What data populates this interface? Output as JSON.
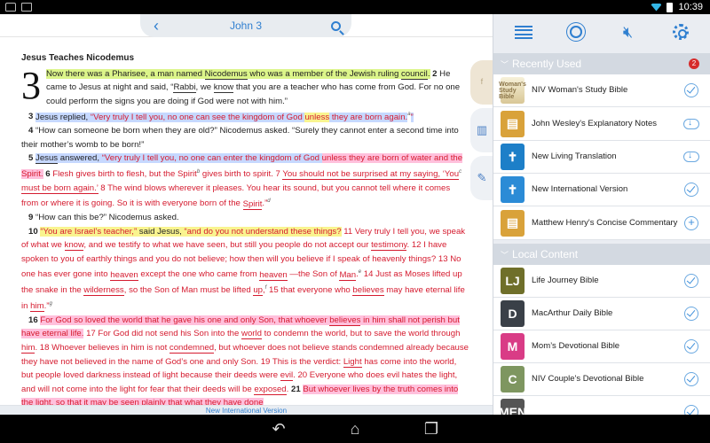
{
  "status_bar": {
    "time": "10:39"
  },
  "reader": {
    "title": "John 3",
    "heading": "Jesus Teaches Nicodemus",
    "chapter_number": "3",
    "version_label": "New International Version",
    "verses": [
      {
        "parts": [
          {
            "t": "Now there was a Pharisee, a man named ",
            "c": "hl-g"
          },
          {
            "t": "Nicodemus",
            "c": "hl-g ulb"
          },
          {
            "t": " who was a member of the Jewish ruling ",
            "c": "hl-g"
          },
          {
            "t": "council",
            "c": "hl-g ulb"
          },
          {
            "t": ".",
            "c": "hl-g"
          },
          {
            "t": " 2 ",
            "c": "vn"
          },
          {
            "t": "He came to Jesus at night and said, “",
            "c": ""
          },
          {
            "t": "Rabbi",
            "c": "ulb"
          },
          {
            "t": ", we ",
            "c": ""
          },
          {
            "t": "know",
            "c": "ulb"
          },
          {
            "t": " that you are a teacher who has come from God. For no one could perform the signs you are doing if God were not with him.”",
            "c": ""
          }
        ],
        "noindent": true
      },
      {
        "parts": [
          {
            "t": "3 ",
            "c": "vn"
          },
          {
            "t": "Jesus replied, ",
            "c": "hl-b"
          },
          {
            "t": "“Very truly I tell you, no one can see the kingdom of God ",
            "c": "hl-b red"
          },
          {
            "t": "unless",
            "c": "hl-y red"
          },
          {
            "t": " they are born again.",
            "c": "hl-b red"
          },
          {
            "t": "a",
            "c": "sup"
          },
          {
            "t": "”",
            "c": "hl-b red"
          }
        ]
      },
      {
        "parts": [
          {
            "t": "4 ",
            "c": "vn"
          },
          {
            "t": "“How can someone be born when they are old?” Nicodemus asked. “Surely they cannot enter a second time into their mother’s womb to be born!”",
            "c": ""
          }
        ]
      },
      {
        "parts": [
          {
            "t": "5 ",
            "c": "vn"
          },
          {
            "t": "Jesus",
            "c": "hl-b ulb"
          },
          {
            "t": " answered, ",
            "c": "hl-b"
          },
          {
            "t": "“Very truly I tell you, no one can enter the kingdom of God ",
            "c": "hl-b red"
          },
          {
            "t": "unless they are born of water and the Spirit.",
            "c": "hl-p red"
          },
          {
            "t": " 6 ",
            "c": "vn"
          },
          {
            "t": "Flesh gives birth to flesh, but the Spirit",
            "c": "red"
          },
          {
            "t": "b",
            "c": "sup"
          },
          {
            "t": " gives birth to spirit. 7 ",
            "c": "red"
          },
          {
            "t": "You should not be surprised at my saying, ‘You",
            "c": "red ul"
          },
          {
            "t": "c",
            "c": "sup"
          },
          {
            "t": " must be born again.’",
            "c": "red ul"
          },
          {
            "t": " 8 The wind blows wherever it pleases. You hear its sound, but you cannot tell where it comes from or where it is going. So it is with everyone born of the ",
            "c": "red"
          },
          {
            "t": "Spirit",
            "c": "red ul"
          },
          {
            "t": ".”",
            "c": "red"
          },
          {
            "t": "d",
            "c": "sup"
          }
        ]
      },
      {
        "parts": [
          {
            "t": "9 ",
            "c": "vn"
          },
          {
            "t": "“How can this be?” Nicodemus asked.",
            "c": ""
          }
        ]
      },
      {
        "parts": [
          {
            "t": "10 ",
            "c": "vn"
          },
          {
            "t": "“You are Israel’s teacher,”",
            "c": "hl-y red"
          },
          {
            "t": " said Jesus, ",
            "c": "hl-y"
          },
          {
            "t": "“and do you not understand these things?",
            "c": "hl-y red"
          },
          {
            "t": " 11 Very truly I tell you, we speak of what we ",
            "c": "red"
          },
          {
            "t": "know",
            "c": "red ul"
          },
          {
            "t": ", and we testify to what we have seen, but still you people do not accept our ",
            "c": "red"
          },
          {
            "t": "testimony",
            "c": "red ul"
          },
          {
            "t": ". 12 I have spoken to you of earthly things and you do not believe; how then will you believe if I speak of heavenly things? 13 No one has ever gone into ",
            "c": "red"
          },
          {
            "t": "heaven",
            "c": "red ul"
          },
          {
            "t": " except the one who came from ",
            "c": "red"
          },
          {
            "t": "heaven",
            "c": "red ul"
          },
          {
            "t": " —the Son of ",
            "c": "red"
          },
          {
            "t": "Man",
            "c": "red ul"
          },
          {
            "t": ".",
            "c": "red"
          },
          {
            "t": "e",
            "c": "sup"
          },
          {
            "t": " 14 Just as Moses lifted up the snake in the ",
            "c": "red"
          },
          {
            "t": "wilderness",
            "c": "red ul"
          },
          {
            "t": ", so the Son of Man must be lifted ",
            "c": "red"
          },
          {
            "t": "up",
            "c": "red ul"
          },
          {
            "t": ",",
            "c": "red"
          },
          {
            "t": "f",
            "c": "sup"
          },
          {
            "t": " 15 that everyone who ",
            "c": "red"
          },
          {
            "t": "believes",
            "c": "red ul"
          },
          {
            "t": " may have eternal life in ",
            "c": "red"
          },
          {
            "t": "him",
            "c": "red ul"
          },
          {
            "t": ".”",
            "c": "red"
          },
          {
            "t": "g",
            "c": "sup"
          }
        ]
      },
      {
        "parts": [
          {
            "t": "16 ",
            "c": "vn"
          },
          {
            "t": "For God so loved the world that he gave his one and only Son, that whoever ",
            "c": "hl-p red"
          },
          {
            "t": "believes",
            "c": "hl-p red ul"
          },
          {
            "t": " in him shall not perish but have eternal life.",
            "c": "hl-p red"
          },
          {
            "t": " 17 For God did not send his Son into the ",
            "c": "red"
          },
          {
            "t": "world",
            "c": "red ul"
          },
          {
            "t": " to condemn the world, but to save the world through ",
            "c": "red"
          },
          {
            "t": "him",
            "c": "red ul"
          },
          {
            "t": ". 18 Whoever believes in him is not ",
            "c": "red"
          },
          {
            "t": "condemned",
            "c": "red ul"
          },
          {
            "t": ", but whoever does not believe stands condemned already because they have not believed in the name of God’s one and only Son. 19 This is the verdict: ",
            "c": "red"
          },
          {
            "t": "Light",
            "c": "red ul"
          },
          {
            "t": " has come into the world, but people loved darkness instead of light because their deeds were ",
            "c": "red"
          },
          {
            "t": "evil",
            "c": "red ul"
          },
          {
            "t": ". 20 Everyone who does evil hates the light, and will not come into the light for fear that their deeds will be ",
            "c": "red"
          },
          {
            "t": "exposed",
            "c": "red ul"
          },
          {
            "t": ". ",
            "c": "red"
          },
          {
            "t": "21 ",
            "c": "vn"
          },
          {
            "t": "But whoever lives by the truth comes into the light, so that it may be seen plainly that what they have done",
            "c": "hl-p red"
          }
        ]
      }
    ]
  },
  "panel": {
    "recently_used": {
      "title": "Recently Used",
      "badge": "2",
      "items": [
        {
          "label": "NIV Woman's Study Bible",
          "icon": "woman-study-bible-cover-icon",
          "book": "b-tan",
          "glyph": "Woman's Study Bible",
          "action": "check"
        },
        {
          "label": "John Wesley's Explanatory Notes",
          "icon": "book-icon",
          "book": "b-gold",
          "glyph": "▤",
          "action": "download"
        },
        {
          "label": "New Living Translation",
          "icon": "bible-icon",
          "book": "b-navy",
          "glyph": "✝",
          "action": "download"
        },
        {
          "label": "New International Version",
          "icon": "bible-icon",
          "book": "b-sky",
          "glyph": "✝",
          "action": "check"
        },
        {
          "label": "Matthew Henry's Concise Commentary",
          "icon": "book-icon",
          "book": "b-gold",
          "glyph": "▤",
          "action": "add"
        }
      ]
    },
    "local_content": {
      "title": "Local Content",
      "items": [
        {
          "label": "Life Journey Bible",
          "icon": "life-journey-cover-icon",
          "book": "b-olive",
          "glyph": "LJ",
          "action": "check"
        },
        {
          "label": "MacArthur Daily Bible",
          "icon": "macarthur-cover-icon",
          "book": "b-dark",
          "glyph": "D",
          "action": "check"
        },
        {
          "label": "Mom’s Devotional Bible",
          "icon": "moms-devotional-cover-icon",
          "book": "b-pink",
          "glyph": "M",
          "action": "check"
        },
        {
          "label": "NIV Couple's Devotional Bible",
          "icon": "couples-devotional-cover-icon",
          "book": "b-green",
          "glyph": "C",
          "action": "check"
        },
        {
          "label": "",
          "icon": "mens-devotional-cover-icon",
          "book": "b-grey",
          "glyph": "MEN",
          "action": "check"
        }
      ]
    }
  }
}
